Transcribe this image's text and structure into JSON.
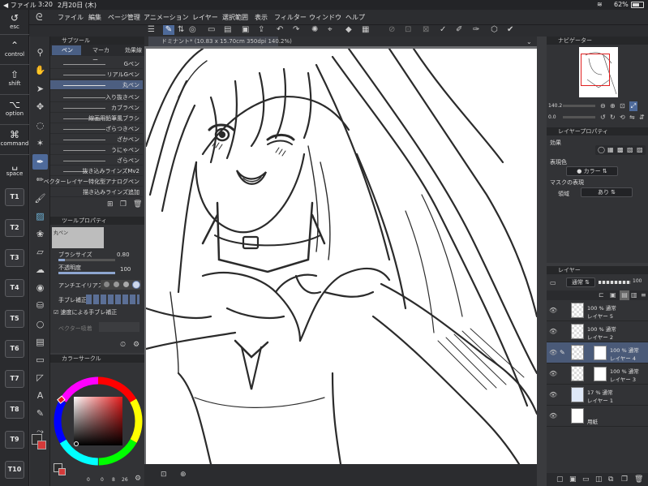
{
  "status": {
    "carrier": "ファイル",
    "time": "3:20",
    "date": "2月20日 (木)",
    "battery": "62%"
  },
  "edge_keys": [
    {
      "glyph": "↺",
      "label": "esc"
    },
    {
      "glyph": "⌃",
      "label": "control"
    },
    {
      "glyph": "⇧",
      "label": "shift"
    },
    {
      "glyph": "⌥",
      "label": "option"
    },
    {
      "glyph": "⌘",
      "label": "command"
    },
    {
      "glyph": "␣",
      "label": "space"
    }
  ],
  "t_buttons": [
    "T1",
    "T2",
    "T3",
    "T4",
    "T5",
    "T6",
    "T7",
    "T8",
    "T9",
    "T10"
  ],
  "menu": [
    "ファイル",
    "編集",
    "ページ管理",
    "アニメーション",
    "レイヤー",
    "選択範囲",
    "表示",
    "フィルター",
    "ウィンドウ",
    "ヘルプ"
  ],
  "subtool": {
    "title": "サブツール",
    "tabs": [
      "ペン",
      "マーカー",
      "効果線"
    ],
    "brushes": [
      "Gペン",
      "リアルGペン",
      "丸ペン",
      "入り抜きペン",
      "カブラペン",
      "線画用鉛筆風ブラシ",
      "ざらつきペン",
      "ざかペン",
      "うにゃペン",
      "ざらペン",
      "抜き込みラインズMv2",
      "ベクターレイヤー特化型アナログペン",
      "描き込みラインズ追加"
    ],
    "selected_index": 2
  },
  "toolprop": {
    "title": "ツールプロパティ",
    "current": "丸ペン",
    "brush_size_label": "ブラシサイズ",
    "brush_size": "0.80",
    "opacity_label": "不透明度",
    "opacity": "100",
    "aa_label": "アンチエイリアス",
    "stab_label": "手ブレ補正",
    "speed_label": "速度による手ブレ補正",
    "vector_label": "ベクター吸着"
  },
  "colorpanel": {
    "title": "カラーサークル",
    "values": [
      "0",
      "0",
      "8",
      "26"
    ]
  },
  "canvas": {
    "tab_title": "ドミナント* (10.83 x 15.70cm 350dpi 140.2%)"
  },
  "navigator": {
    "title": "ナビゲーター",
    "zoom": "140.2",
    "rotation": "0.0"
  },
  "layerprop": {
    "title": "レイヤープロパティ",
    "effect_label": "効果",
    "color_label": "表現色",
    "color_value": "カラー",
    "mask_label": "マスクの表現",
    "region_label": "領域",
    "region_value": "あり"
  },
  "layers": {
    "title": "レイヤー",
    "blend": "通常",
    "opacity": "100",
    "items": [
      {
        "prop": "100 % 通常",
        "name": "レイヤー 5"
      },
      {
        "prop": "100 % 通常",
        "name": "レイヤー 2"
      },
      {
        "prop": "100 % 通常",
        "name": "レイヤー 4"
      },
      {
        "prop": "100 % 通常",
        "name": "レイヤー 3"
      },
      {
        "prop": "17 % 通常",
        "name": "レイヤー 1"
      },
      {
        "prop": "",
        "name": "用紙"
      }
    ],
    "selected_index": 2
  },
  "colors": {
    "accent": "#4e6a9a",
    "selected_row": "#4a5a78",
    "main_color": "#2d2d2d",
    "sub_color": "#d43a3a"
  }
}
